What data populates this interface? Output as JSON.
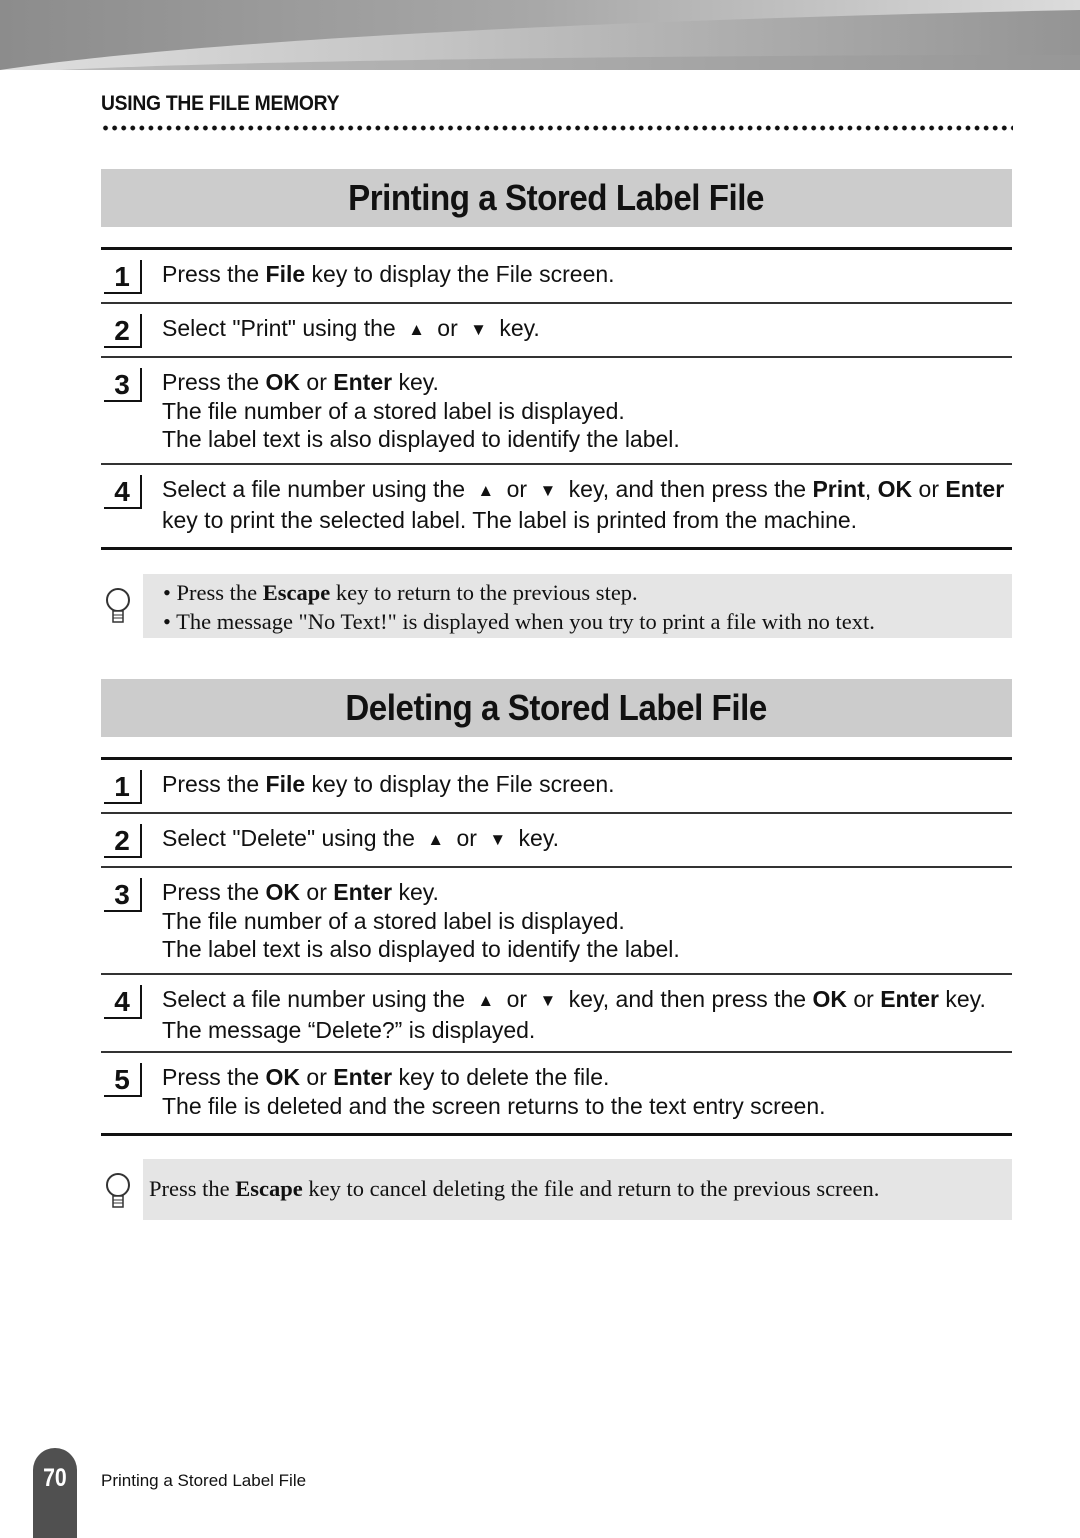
{
  "header": {
    "chapter_title": "USING THE FILE MEMORY"
  },
  "sections": [
    {
      "title": "Printing a Stored Label File",
      "steps": [
        {
          "number": "1",
          "lines": [
            [
              {
                "t": "Press the "
              },
              {
                "t": "File",
                "b": true
              },
              {
                "t": " key to display the File screen."
              }
            ]
          ]
        },
        {
          "number": "2",
          "lines": [
            [
              {
                "t": "Select \"Print\" using the "
              },
              {
                "icon": "up"
              },
              {
                "t": " or "
              },
              {
                "icon": "down"
              },
              {
                "t": " key."
              }
            ]
          ]
        },
        {
          "number": "3",
          "lines": [
            [
              {
                "t": "Press the "
              },
              {
                "t": "OK",
                "b": true
              },
              {
                "t": " or "
              },
              {
                "t": "Enter",
                "b": true
              },
              {
                "t": " key."
              }
            ],
            [
              {
                "t": "The file number of a stored label is displayed."
              }
            ],
            [
              {
                "t": "The label text is also displayed to identify the label."
              }
            ]
          ]
        },
        {
          "number": "4",
          "lines": [
            [
              {
                "t": "Select a file number using the "
              },
              {
                "icon": "up"
              },
              {
                "t": " or "
              },
              {
                "icon": "down"
              },
              {
                "t": " key, and then press the "
              },
              {
                "t": "Print",
                "b": true
              },
              {
                "t": ", "
              },
              {
                "t": "OK",
                "b": true
              },
              {
                "t": " or "
              },
              {
                "t": "Enter",
                "b": true
              }
            ],
            [
              {
                "t": "key to print the selected  label. The label is printed from the machine."
              }
            ]
          ]
        }
      ],
      "note": [
        [
          {
            "t": "• Press the "
          },
          {
            "t": "Escape",
            "b": true
          },
          {
            "t": " key to return to the previous step."
          }
        ],
        [
          {
            "t": "• The message \"No Text!\" is displayed when you try to print a file with no text."
          }
        ]
      ]
    },
    {
      "title": "Deleting a Stored Label File",
      "steps": [
        {
          "number": "1",
          "lines": [
            [
              {
                "t": "Press the "
              },
              {
                "t": "File",
                "b": true
              },
              {
                "t": " key to display the File screen."
              }
            ]
          ]
        },
        {
          "number": "2",
          "lines": [
            [
              {
                "t": "Select \"Delete\" using the "
              },
              {
                "icon": "up"
              },
              {
                "t": " or "
              },
              {
                "icon": "down"
              },
              {
                "t": " key."
              }
            ]
          ]
        },
        {
          "number": "3",
          "lines": [
            [
              {
                "t": "Press the "
              },
              {
                "t": "OK",
                "b": true
              },
              {
                "t": " or "
              },
              {
                "t": "Enter",
                "b": true
              },
              {
                "t": " key."
              }
            ],
            [
              {
                "t": "The file number of a stored label is displayed."
              }
            ],
            [
              {
                "t": "The label text is also displayed to identify the label."
              }
            ]
          ]
        },
        {
          "number": "4",
          "lines": [
            [
              {
                "t": "Select a file number using the "
              },
              {
                "icon": "up"
              },
              {
                "t": " or "
              },
              {
                "icon": "down"
              },
              {
                "t": " key, and then press the "
              },
              {
                "t": "OK",
                "b": true
              },
              {
                "t": " or "
              },
              {
                "t": "Enter",
                "b": true
              },
              {
                "t": " key."
              }
            ],
            [
              {
                "t": "The message “Delete?” is displayed."
              }
            ]
          ]
        },
        {
          "number": "5",
          "lines": [
            [
              {
                "t": "Press the "
              },
              {
                "t": "OK",
                "b": true
              },
              {
                "t": " or "
              },
              {
                "t": "Enter",
                "b": true
              },
              {
                "t": " key to delete the file."
              }
            ],
            [
              {
                "t": "The file is deleted and the screen returns to the text entry screen."
              }
            ]
          ]
        }
      ],
      "note": [
        [
          {
            "t": "Press the "
          },
          {
            "t": "Escape",
            "b": true
          },
          {
            "t": " key to cancel deleting the file and return to the previous screen."
          }
        ]
      ]
    }
  ],
  "icons": {
    "up": "▲",
    "down": "▼",
    "note": "lightbulb-icon"
  },
  "footer": {
    "page_number": "70",
    "section_name": "Printing a Stored Label File"
  }
}
